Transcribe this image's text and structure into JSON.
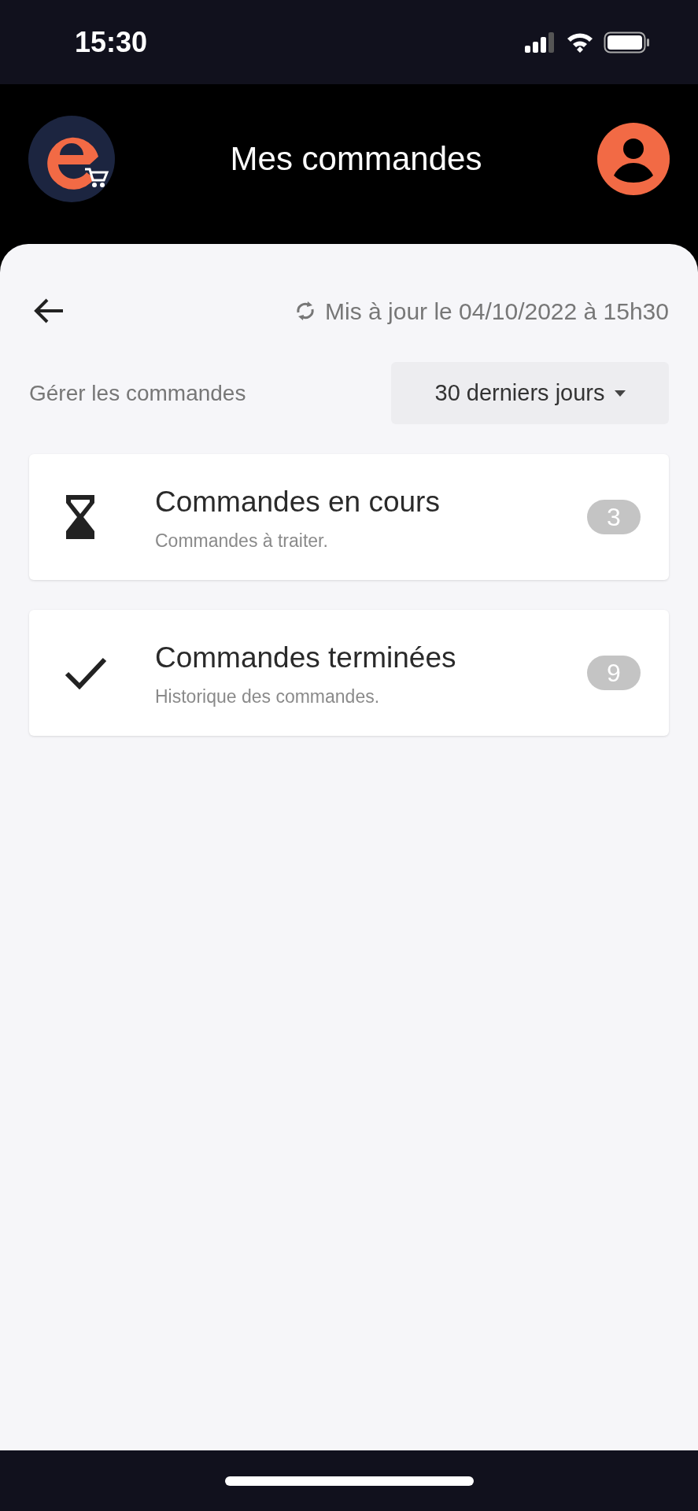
{
  "status_bar": {
    "time": "15:30"
  },
  "header": {
    "title": "Mes commandes"
  },
  "toolbar": {
    "updated": "Mis à jour le 04/10/2022 à 15h30"
  },
  "filter": {
    "label": "Gérer les commandes",
    "period": "30 derniers jours"
  },
  "cards": [
    {
      "kind": "pending",
      "title": "Commandes en cours",
      "subtitle": "Commandes à traiter.",
      "count": "3"
    },
    {
      "kind": "done",
      "title": "Commandes terminées",
      "subtitle": "Historique des commandes.",
      "count": "9"
    }
  ]
}
